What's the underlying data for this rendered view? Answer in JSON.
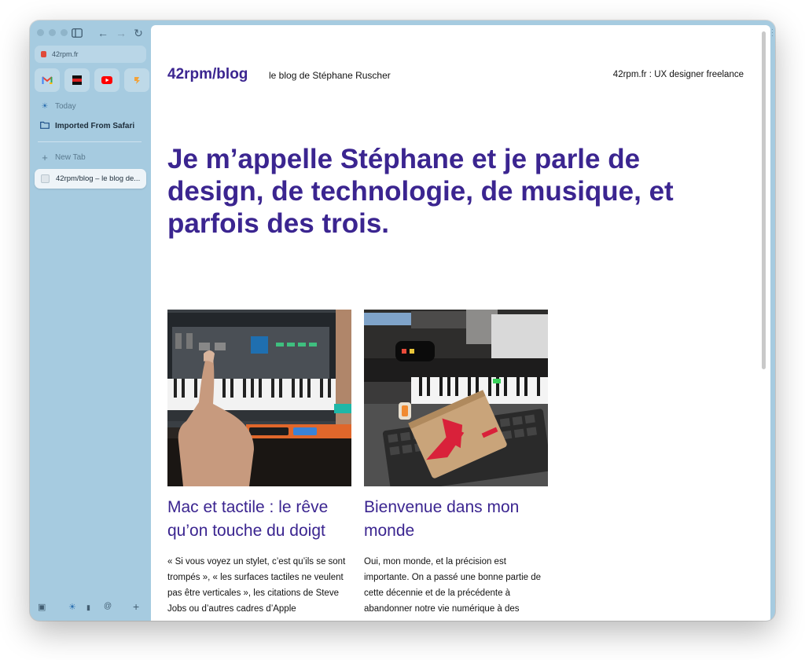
{
  "sidebar": {
    "address": "42rpm.fr",
    "favorites": [
      {
        "icon": "gmail-icon"
      },
      {
        "icon": "bookmark-app-icon"
      },
      {
        "icon": "youtube-icon"
      },
      {
        "icon": "app-icon"
      }
    ],
    "today_label": "Today",
    "folder_label": "Imported From Safari",
    "new_tab_label": "New Tab",
    "active_tab_label": "42rpm/blog – le blog de..."
  },
  "page": {
    "site_title": "42rpm/blog",
    "site_subtitle": "le blog de Stéphane Ruscher",
    "header_link": "42rpm.fr : UX designer freelance",
    "hero": "Je m’appelle Stéphane et je parle de design, de technologie, de musique, et parfois des trois.",
    "articles": [
      {
        "title": "Mac et tactile : le rêve qu’on touche du doigt",
        "excerpt": "« Si vous voyez un stylet, c’est qu’ils se sont trompés », « les surfaces tactiles ne veulent pas être verticales », les citations de Steve Jobs ou d’autres cadres d’Apple"
      },
      {
        "title": "Bienvenue dans mon monde",
        "excerpt": "Oui, mon monde, et la précision est importante. On a passé une bonne partie de cette décennie et de la précédente à abandonner notre vie numérique à des"
      }
    ]
  },
  "colors": {
    "accent": "#3b2590",
    "sidebar_bg": "#a6cbe0"
  }
}
